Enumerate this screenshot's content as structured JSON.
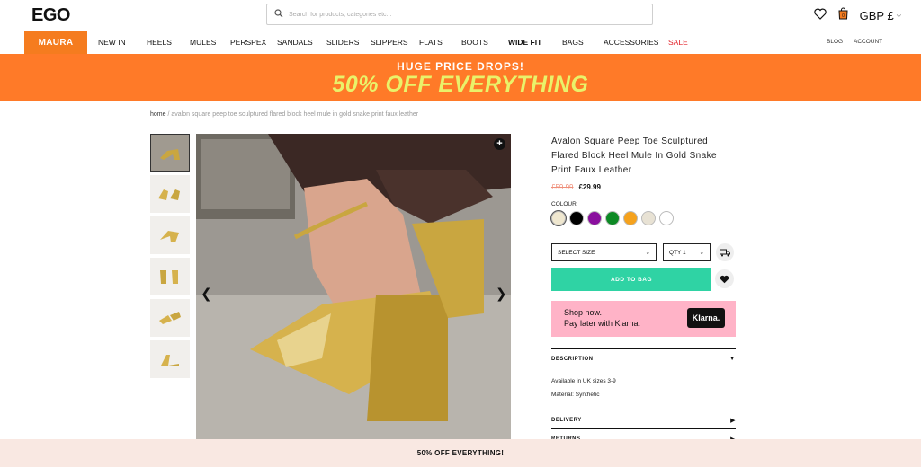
{
  "header": {
    "logo": "EGO",
    "search_placeholder": "Search for products, categories etc...",
    "currency": "GBP £"
  },
  "nav": {
    "brand": "MAURA",
    "items": [
      "NEW IN",
      "HEELS",
      "MULES",
      "PERSPEX",
      "SANDALS",
      "SLIDERS",
      "SLIPPERS",
      "FLATS",
      "BOOTS",
      "WIDE FIT",
      "BAGS",
      "ACCESSORIES",
      "SALE"
    ],
    "blog": "BLOG",
    "account": "ACCOUNT"
  },
  "banner": {
    "line1": "HUGE PRICE DROPS!",
    "line2": "50% OFF EVERYTHING"
  },
  "breadcrumb": {
    "home": "home",
    "separator": " / ",
    "current": "avalon square peep toe sculptured flared block heel mule in gold snake print faux leather"
  },
  "product": {
    "title": "Avalon Square Peep Toe Sculptured Flared Block Heel Mule In Gold Snake Print Faux Leather",
    "price_was": "£59.99",
    "price_now": "£29.99",
    "colour_label": "COLOUR:",
    "colours": [
      "#efe7cf",
      "#000000",
      "#8a0f9e",
      "#0d8a25",
      "#f5a21d",
      "#e8e2d4",
      "#ffffff"
    ],
    "size_select": "SELECT SIZE",
    "qty_select": "QTY 1",
    "add_to_bag": "ADD TO BAG"
  },
  "klarna": {
    "line1": "Shop now.",
    "line2": "Pay later with Klarna.",
    "logo": "Klarna."
  },
  "accordion": {
    "description": "DESCRIPTION",
    "desc_line1": "Available in UK sizes 3-9",
    "desc_line2": "Material: Synthetic",
    "delivery": "DELIVERY",
    "returns": "RETURNS"
  },
  "footer": {
    "text": "50% OFF EVERYTHING!"
  }
}
